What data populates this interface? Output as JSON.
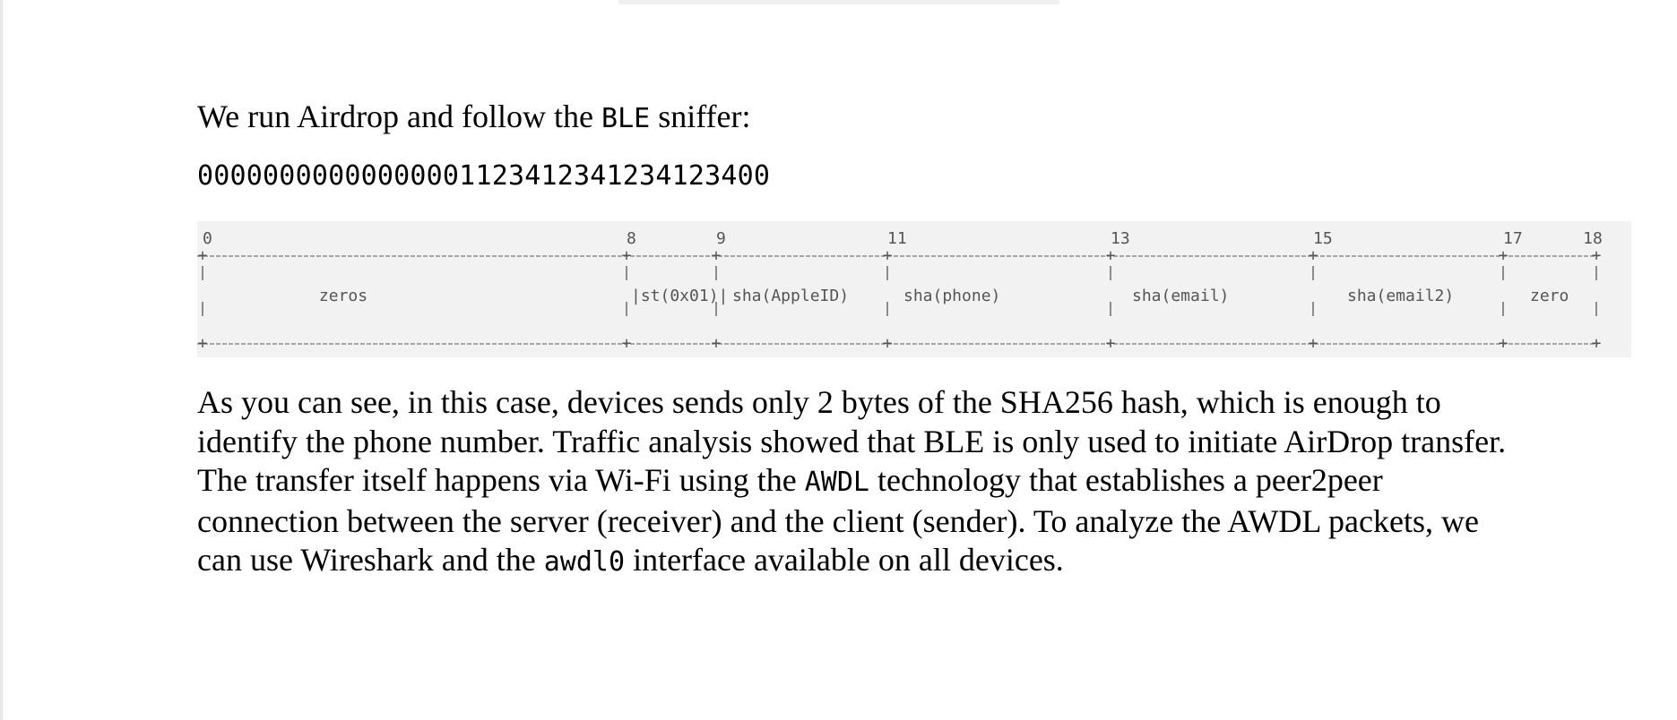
{
  "intro": {
    "part1": "We run Airdrop and follow the ",
    "code": "BLE",
    "part2": " sniffer:"
  },
  "hex_value": "0000000000000000112341234123412340 0",
  "diagram": {
    "offsets": [
      "0",
      "8",
      "9",
      "11",
      "13",
      "15",
      "17",
      "18"
    ],
    "fields": [
      "zeros",
      "|st(0x01)|",
      "sha(AppleID)",
      "sha(phone)",
      "sha(email)",
      "sha(email2)",
      "zero"
    ]
  },
  "body": {
    "s1": "As you can see, in this case, devices sends only 2 bytes of the SHA256 hash, which is enough to identify the phone number. Traffic analysis showed that BLE is only used to initiate AirDrop transfer. The transfer itself happens via Wi-Fi using the ",
    "code1": "AWDL",
    "s2": " technology that establishes a peer2peer connection between the server (receiver) and the client (sender). To analyze the AWDL packets, we can use Wireshark and the ",
    "code2": "awdl0",
    "s3": " interface available on all devices."
  }
}
